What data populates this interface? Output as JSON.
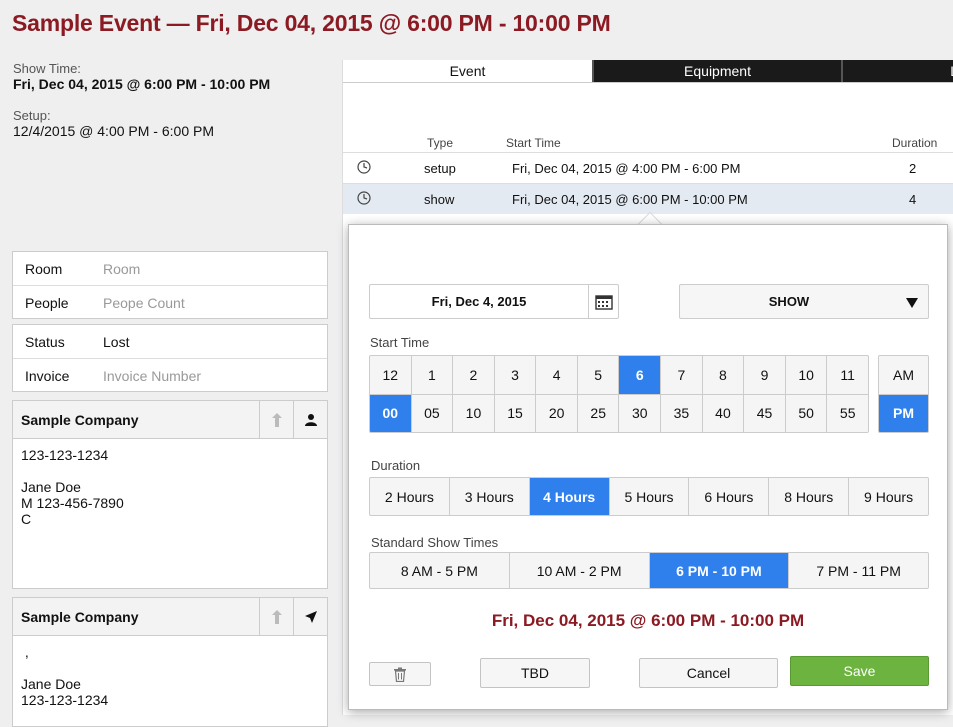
{
  "title": "Sample Event — Fri, Dec 04, 2015 @  6:00 PM - 10:00 PM",
  "show_time": {
    "label": "Show Time:",
    "value": "Fri, Dec 04, 2015 @ 6:00 PM - 10:00 PM"
  },
  "setup": {
    "label": "Setup:",
    "value": "12/4/2015 @ 4:00 PM - 6:00 PM"
  },
  "fields": {
    "room": {
      "label": "Room",
      "placeholder": "Room"
    },
    "people": {
      "label": "People",
      "placeholder": "Peope Count"
    },
    "status": {
      "label": "Status",
      "value": "Lost"
    },
    "invoice": {
      "label": "Invoice",
      "placeholder": "Invoice Number"
    }
  },
  "contacts": [
    {
      "company": "Sample Company",
      "body": "123-123-1234\n\nJane Doe\nM 123-456-7890\nC",
      "icon": "person-icon"
    },
    {
      "company": "Sample Company",
      "body": " ,\n\nJane Doe\n123-123-1234",
      "icon": "location-arrow-icon"
    }
  ],
  "tabs": [
    "Event",
    "Equipment",
    "L"
  ],
  "schedule": {
    "headers": {
      "type": "Type",
      "start": "Start Time",
      "duration": "Duration"
    },
    "rows": [
      {
        "type": "setup",
        "start": "Fri, Dec 04, 2015 @ 4:00 PM - 6:00 PM",
        "duration": "2"
      },
      {
        "type": "show",
        "start": "Fri, Dec 04, 2015 @ 6:00 PM - 10:00 PM",
        "duration": "4"
      }
    ]
  },
  "editor": {
    "date": "Fri, Dec 4, 2015",
    "type_select": "SHOW",
    "start_time_label": "Start Time",
    "hours": [
      "12",
      "1",
      "2",
      "3",
      "4",
      "5",
      "6",
      "7",
      "8",
      "9",
      "10",
      "11"
    ],
    "selected_hour": "6",
    "minutes": [
      "00",
      "05",
      "10",
      "15",
      "20",
      "25",
      "30",
      "35",
      "40",
      "45",
      "50",
      "55"
    ],
    "selected_minute": "00",
    "meridiem": [
      "AM",
      "PM"
    ],
    "selected_meridiem": "PM",
    "duration_label": "Duration",
    "durations": [
      "2 Hours",
      "3 Hours",
      "4 Hours",
      "5 Hours",
      "6 Hours",
      "8 Hours",
      "9 Hours"
    ],
    "selected_duration": "4 Hours",
    "standard_label": "Standard Show Times",
    "standard_times": [
      "8 AM - 5 PM",
      "10 AM - 2 PM",
      "6 PM - 10 PM",
      "7 PM - 11 PM"
    ],
    "selected_standard": "6 PM - 10 PM",
    "summary": "Fri, Dec 04, 2015 @ 6:00 PM - 10:00 PM",
    "tbd_label": "TBD",
    "cancel_label": "Cancel",
    "save_label": "Save"
  },
  "colors": {
    "title": "#8b1a22",
    "selected": "#2f80ed",
    "save": "#6cb33f"
  }
}
